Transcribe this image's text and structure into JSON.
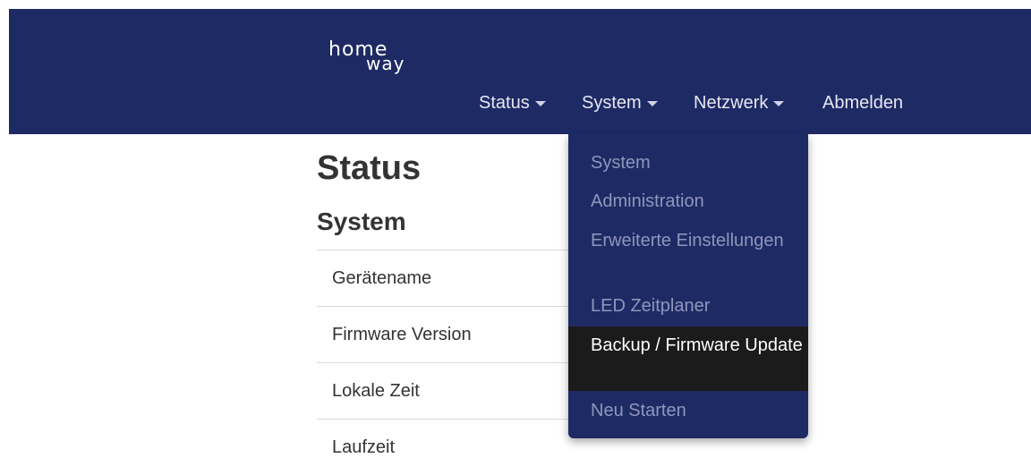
{
  "brand": {
    "logo_line1": "home",
    "logo_line2": "way"
  },
  "nav": {
    "items": [
      {
        "label": "Status",
        "has_caret": true
      },
      {
        "label": "System",
        "has_caret": true
      },
      {
        "label": "Netzwerk",
        "has_caret": true
      },
      {
        "label": "Abmelden",
        "has_caret": false
      }
    ]
  },
  "dropdown": {
    "parent": "System",
    "items": [
      {
        "label": "System"
      },
      {
        "label": "Administration"
      },
      {
        "label": "Erweiterte Einstellungen"
      },
      {
        "label": "LED Zeitplaner"
      },
      {
        "label": "Backup / Firmware Update",
        "active": true
      },
      {
        "label": "Neu Starten"
      }
    ]
  },
  "main": {
    "title": "Status",
    "subtitle": "System",
    "rows": [
      {
        "label": "Gerätename"
      },
      {
        "label": "Firmware Version"
      },
      {
        "label": "Lokale Zeit"
      },
      {
        "label": "Laufzeit"
      }
    ]
  },
  "colors": {
    "navbar_bg": "#1e2a64",
    "dropdown_active_bg": "#1b1b1b",
    "text_dark": "#333333"
  }
}
